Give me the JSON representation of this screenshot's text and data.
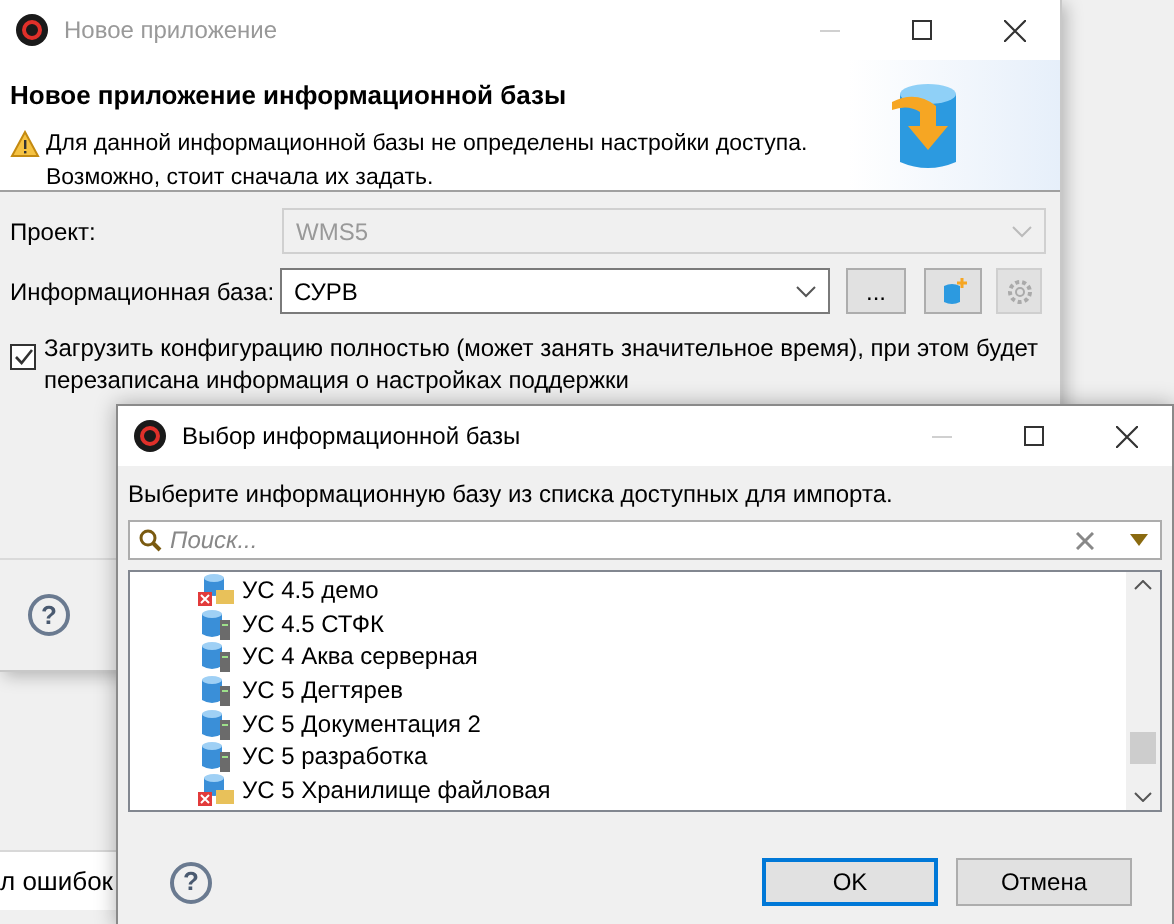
{
  "background_window": {
    "title": "Новое приложение",
    "heading": "Новое приложение информационной базы",
    "warning": "Для данной информационной базы не определены настройки доступа. Возможно, стоит сначала их задать.",
    "project": {
      "label": "Проект:",
      "value": "WMS5",
      "disabled": true
    },
    "infobase": {
      "label": "Информационная база:",
      "value": "СУРВ",
      "browse_button": "..."
    },
    "full_load": {
      "label": "Загрузить конфигурацию полностью (может занять значительное время), при этом будет перезаписана информация о настройках поддержки",
      "checked": true
    }
  },
  "background_help": {
    "label": "?"
  },
  "background_tab": {
    "label": "л ошибок"
  },
  "dialog": {
    "title": "Выбор информационной базы",
    "instruction": "Выберите информационную базу из списка доступных для импорта.",
    "search": {
      "placeholder": "Поиск..."
    },
    "items": [
      {
        "name": "УС 4.5 демо",
        "kind": "file_error"
      },
      {
        "name": "УС 4.5 СТФК",
        "kind": "server"
      },
      {
        "name": "УС 4 Аква серверная",
        "kind": "server"
      },
      {
        "name": "УС 5 Дегтярев",
        "kind": "server"
      },
      {
        "name": "УС 5 Документация 2",
        "kind": "server"
      },
      {
        "name": "УС 5 разработка",
        "kind": "server"
      },
      {
        "name": "УС 5 Хранилище файловая",
        "kind": "file_error"
      }
    ],
    "help": {
      "label": "?"
    },
    "buttons": [
      {
        "label": "OK",
        "default": true
      },
      {
        "label": "Отмена",
        "default": false
      }
    ]
  }
}
